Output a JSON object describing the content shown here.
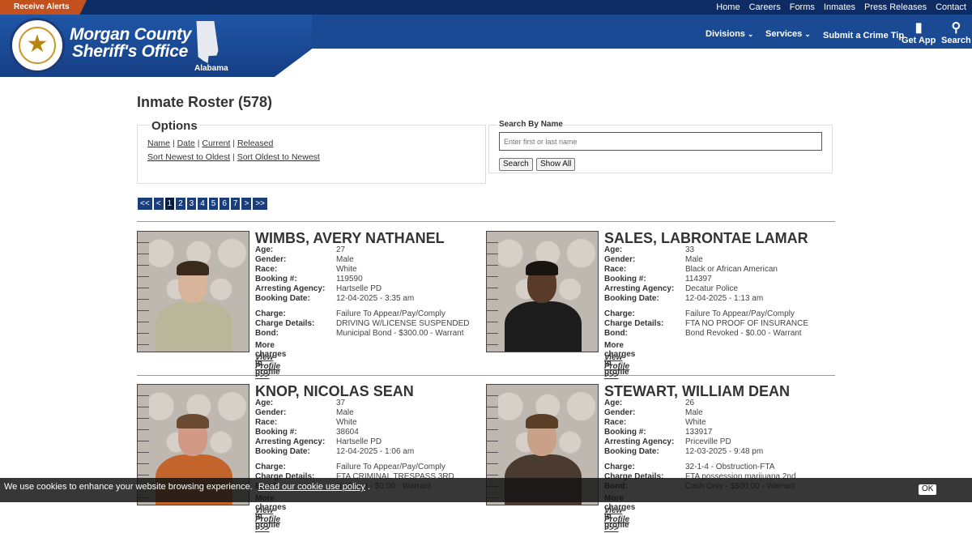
{
  "topbar": {
    "alerts_label": "Receive Alerts",
    "links": [
      "Home",
      "Careers",
      "Forms",
      "Inmates",
      "Press Releases",
      "Contact"
    ]
  },
  "brand": {
    "line1": "Morgan County",
    "line2": "Sheriff's Office",
    "state": "Alabama"
  },
  "nav": {
    "divisions": "Divisions",
    "services": "Services",
    "crime_tip": "Submit a Crime Tip",
    "get_app": "Get App",
    "search": "Search"
  },
  "page": {
    "title": "Inmate Roster (578)"
  },
  "options": {
    "legend": "Options",
    "row1": [
      "Name",
      "Date",
      "Current",
      "Released"
    ],
    "row2": [
      "Sort Newest to Oldest",
      "Sort Oldest to Newest"
    ],
    "sep": "|"
  },
  "search": {
    "legend": "Search By Name",
    "placeholder": "Enter first or last name",
    "search_button": "Search",
    "show_all_button": "Show All"
  },
  "pager": [
    "<<",
    "<",
    "1",
    "2",
    "3",
    "4",
    "5",
    "6",
    "7",
    ">",
    ">>"
  ],
  "labels": {
    "age": "Age:",
    "gender": "Gender:",
    "race": "Race:",
    "booking": "Booking #:",
    "agency": "Arresting Agency:",
    "date": "Booking Date:",
    "charge": "Charge:",
    "details": "Charge Details:",
    "bond": "Bond:",
    "more": "More charges in profile",
    "view": "View Profile >>>"
  },
  "inmates": [
    {
      "name": "WIMBS, AVERY NATHANEL",
      "age": "27",
      "gender": "Male",
      "race": "White",
      "booking": "119590",
      "agency": "Hartselle PD",
      "date": "12-04-2025 - 3:35 am",
      "charge": "Failure To Appear/Pay/Comply",
      "details": "DRIVING W/LICENSE SUSPENDED",
      "bond": "Municipal Bond - $300.00 - Warrant",
      "skin": "#d7b49a",
      "shirt": "#b9b69a",
      "hair": "#3a2a1e"
    },
    {
      "name": "SALES, LABRONTAE LAMAR",
      "age": "33",
      "gender": "Male",
      "race": "Black or African American",
      "booking": "114397",
      "agency": "Decatur Police",
      "date": "12-04-2025 - 1:13 am",
      "charge": "Failure To Appear/Pay/Comply",
      "details": "FTA NO PROOF OF INSURANCE",
      "bond": "Bond Revoked - $0.00 - Warrant",
      "skin": "#5a3a28",
      "shirt": "#1c1c1c",
      "hair": "#1a1410"
    },
    {
      "name": "KNOP, NICOLAS SEAN",
      "age": "37",
      "gender": "Male",
      "race": "White",
      "booking": "38604",
      "agency": "Hartselle PD",
      "date": "12-04-2025 - 1:06 am",
      "charge": "Failure To Appear/Pay/Comply",
      "details": "FTA CRIMINAL TRESPASS 3RD",
      "bond": "No Bond - $0.00 - Warrant",
      "skin": "#d29a84",
      "shirt": "#c3642a",
      "hair": "#6b4a32"
    },
    {
      "name": "STEWART, WILLIAM DEAN",
      "age": "26",
      "gender": "Male",
      "race": "White",
      "booking": "133917",
      "agency": "Priceville PD",
      "date": "12-03-2025 - 9:48 pm",
      "charge": "32-1-4 - Obstruction-FTA",
      "details": "FTA possession marijuana 2nd",
      "bond": "Cash Only - $500.00 - Warrant",
      "skin": "#c9a088",
      "shirt": "#4a3a30",
      "hair": "#5a3e26"
    }
  ],
  "cookie": {
    "text": "We use cookies to enhance your website browsing experience.",
    "link": "Read our cookie use policy",
    "ok": "OK"
  }
}
